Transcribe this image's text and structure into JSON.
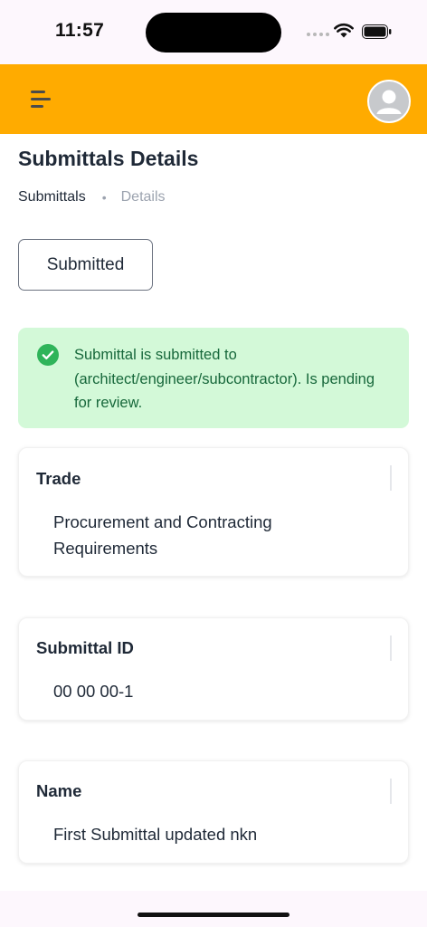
{
  "status_bar": {
    "time": "11:57"
  },
  "header": {
    "menu_icon": "menu-icon",
    "avatar_icon": "user-avatar-icon",
    "background_color": "#ffab00"
  },
  "page": {
    "title": "Submittals Details",
    "breadcrumb": {
      "link": "Submittals",
      "separator": "•",
      "current": "Details"
    },
    "status_button": "Submitted"
  },
  "alert": {
    "icon": "check-circle-icon",
    "text": "Submittal is submitted to (architect/engineer/subcontractor). Is pending for review.",
    "background_color": "#d3f9d8",
    "text_color": "#17683b"
  },
  "fields": {
    "trade": {
      "label": "Trade",
      "value": "Procurement and Contracting Requirements"
    },
    "submittal_id": {
      "label": "Submittal ID",
      "value": "00 00 00-1"
    },
    "name": {
      "label": "Name",
      "value": "First Submittal updated nkn"
    }
  }
}
